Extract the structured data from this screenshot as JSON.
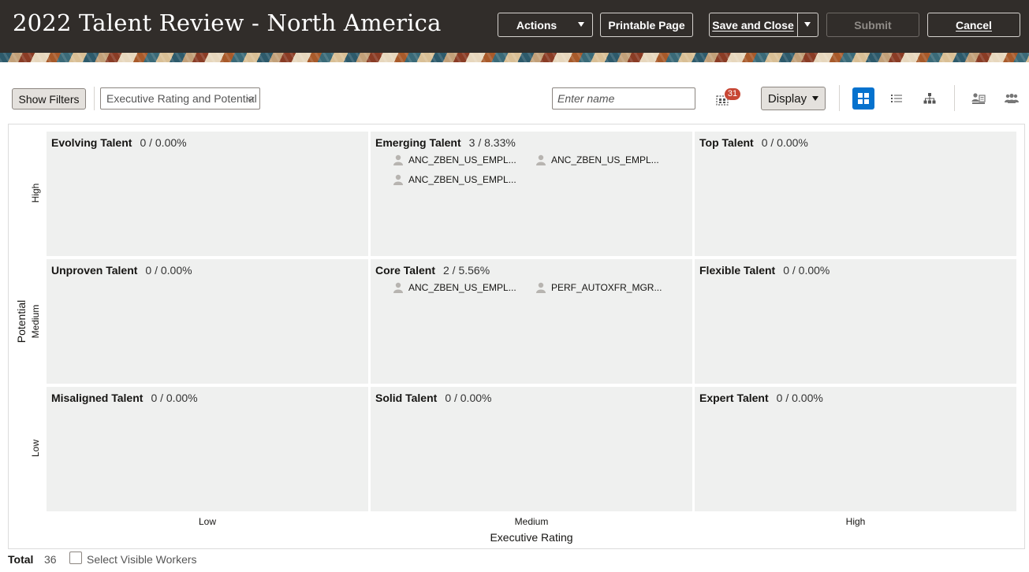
{
  "header": {
    "title": "2022 Talent Review - North America",
    "buttons": {
      "actions": "Actions",
      "printable": "Printable Page",
      "save_close": "Save and Close",
      "submit": "Submit",
      "cancel": "Cancel"
    }
  },
  "toolbar": {
    "show_filters": "Show Filters",
    "view_select": "Executive Rating and Potential",
    "name_placeholder": "Enter name",
    "badge_count": "31",
    "display_label": "Display",
    "icons": [
      "select-grid-icon",
      "grid-view-icon",
      "list-view-icon",
      "hierarchy-icon",
      "person-card-icon",
      "group-icon"
    ]
  },
  "grid": {
    "y_axis_title": "Potential",
    "x_axis_title": "Executive Rating",
    "rows": [
      "High",
      "Medium",
      "Low"
    ],
    "cols": [
      "Low",
      "Medium",
      "High"
    ],
    "cells": [
      {
        "name": "Evolving Talent",
        "count": "0 / 0.00%",
        "employees": []
      },
      {
        "name": "Emerging Talent",
        "count": "3 / 8.33%",
        "employees": [
          "ANC_ZBEN_US_EMPL...",
          "ANC_ZBEN_US_EMPL...",
          "ANC_ZBEN_US_EMPL..."
        ]
      },
      {
        "name": "Top Talent",
        "count": "0 / 0.00%",
        "employees": []
      },
      {
        "name": "Unproven Talent",
        "count": "0 / 0.00%",
        "employees": []
      },
      {
        "name": "Core Talent",
        "count": "2 / 5.56%",
        "employees": [
          "ANC_ZBEN_US_EMPL...",
          "PERF_AUTOXFR_MGR..."
        ]
      },
      {
        "name": "Flexible Talent",
        "count": "0 / 0.00%",
        "employees": []
      },
      {
        "name": "Misaligned Talent",
        "count": "0 / 0.00%",
        "employees": []
      },
      {
        "name": "Solid Talent",
        "count": "0 / 0.00%",
        "employees": []
      },
      {
        "name": "Expert Talent",
        "count": "0 / 0.00%",
        "employees": []
      }
    ]
  },
  "footer": {
    "total_label": "Total",
    "total_value": "36",
    "select_visible": "Select Visible Workers"
  },
  "colors": {
    "header_bg": "#312d2a",
    "cell_bg": "#eff0ef",
    "accent": "#0572ce",
    "badge": "#c74634"
  }
}
